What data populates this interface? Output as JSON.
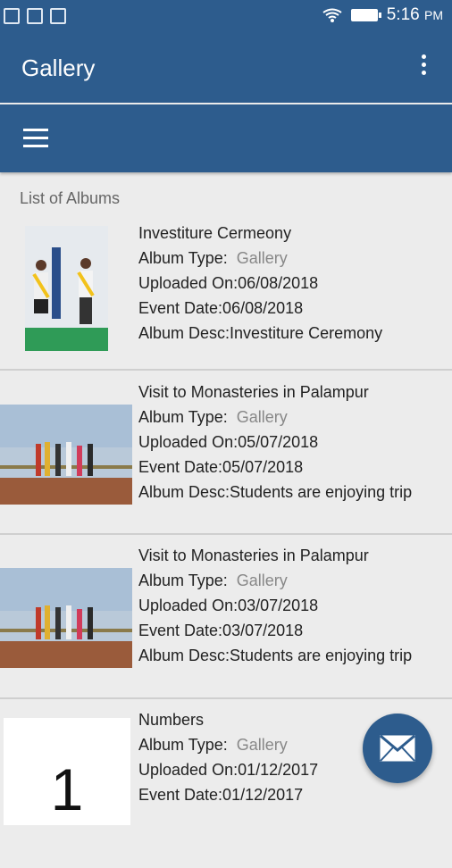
{
  "status": {
    "time": "5:16",
    "ampm": "PM"
  },
  "app": {
    "title": "Gallery"
  },
  "list": {
    "title": "List of Albums"
  },
  "albums": [
    {
      "name": "Investiture Cermeony",
      "type_label": "Album Type:",
      "type_value": "Gallery",
      "uploaded": "Uploaded On:06/08/2018",
      "event": "Event Date:06/08/2018",
      "desc": "Album Desc:Investiture Ceremony"
    },
    {
      "name": "Visit to Monasteries in Palampur",
      "type_label": "Album Type:",
      "type_value": "Gallery",
      "uploaded": "Uploaded On:05/07/2018",
      "event": "Event Date:05/07/2018",
      "desc": "Album Desc:Students are enjoying trip"
    },
    {
      "name": "Visit to Monasteries in Palampur",
      "type_label": "Album Type:",
      "type_value": "Gallery",
      "uploaded": "Uploaded On:03/07/2018",
      "event": "Event Date:03/07/2018",
      "desc": "Album Desc:Students are enjoying trip"
    },
    {
      "name": "Numbers",
      "type_label": "Album Type:",
      "type_value": "Gallery",
      "uploaded": "Uploaded On:01/12/2017",
      "event": "Event Date:01/12/2017",
      "thumb_text": "1"
    }
  ],
  "icons": {
    "menu": "hamburger-icon",
    "overflow": "more-vert-icon",
    "fab": "mail-icon"
  },
  "colors": {
    "primary": "#2d5c8d",
    "background": "#ececec"
  }
}
